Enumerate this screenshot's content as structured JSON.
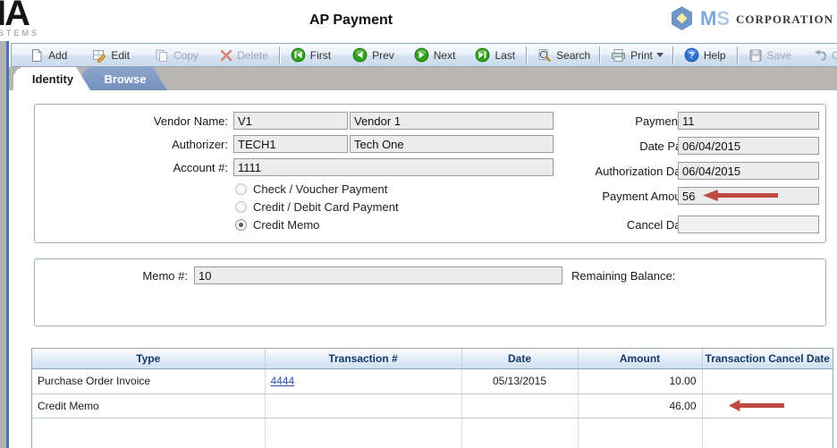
{
  "header": {
    "logo_line1": "IA",
    "logo_line2": "STEMS",
    "title": "AP Payment",
    "brand_m": "M",
    "brand_s": "S",
    "brand_corp": "CORPORATION"
  },
  "toolbar": {
    "add": "Add",
    "edit": "Edit",
    "copy": "Copy",
    "delete": "Delete",
    "first": "First",
    "prev": "Prev",
    "next": "Next",
    "last": "Last",
    "search": "Search",
    "print": "Print",
    "help": "Help",
    "save": "Save",
    "cancel": "Cancel"
  },
  "tabs": {
    "identity": "Identity",
    "browse": "Browse"
  },
  "form": {
    "vendor": {
      "label": "Vendor Name:",
      "code": "V1",
      "name": "Vendor 1"
    },
    "authorizer": {
      "label": "Authorizer:",
      "code": "TECH1",
      "name": "Tech One"
    },
    "account": {
      "label": "Account #:",
      "value": "1111"
    },
    "radios": {
      "check_voucher": "Check / Voucher Payment",
      "credit_debit": "Credit / Debit Card Payment",
      "credit_memo": "Credit Memo",
      "selected": "Credit Memo"
    },
    "payment_no": {
      "label": "Payment #:",
      "value": "11"
    },
    "date_paid": {
      "label": "Date Paid:",
      "value": "06/04/2015"
    },
    "auth_date": {
      "label": "Authorization Date:",
      "value": "06/04/2015"
    },
    "payment_amount": {
      "label": "Payment Amount:",
      "value": "56"
    },
    "cancel_date": {
      "label": "Cancel Date:",
      "value": ""
    }
  },
  "memo": {
    "memo_no": {
      "label": "Memo #:",
      "value": "10"
    },
    "remaining_balance_label": "Remaining Balance:"
  },
  "table": {
    "headers": [
      "Type",
      "Transaction #",
      "Date",
      "Amount",
      "Transaction Cancel Date"
    ],
    "rows": [
      {
        "type": "Purchase Order Invoice",
        "transaction": "4444",
        "date": "05/13/2015",
        "amount": "10.00",
        "cancel_date": ""
      },
      {
        "type": "Credit Memo",
        "transaction": "",
        "date": "",
        "amount": "46.00",
        "cancel_date": ""
      }
    ]
  },
  "colors": {
    "annotation_arrow": "#bf4a43",
    "inactive_tab_blue": "#7590bd",
    "link_blue": "#2b4fa0",
    "table_header_text": "#17386b",
    "nav_icon_green": "#2fa11c"
  }
}
